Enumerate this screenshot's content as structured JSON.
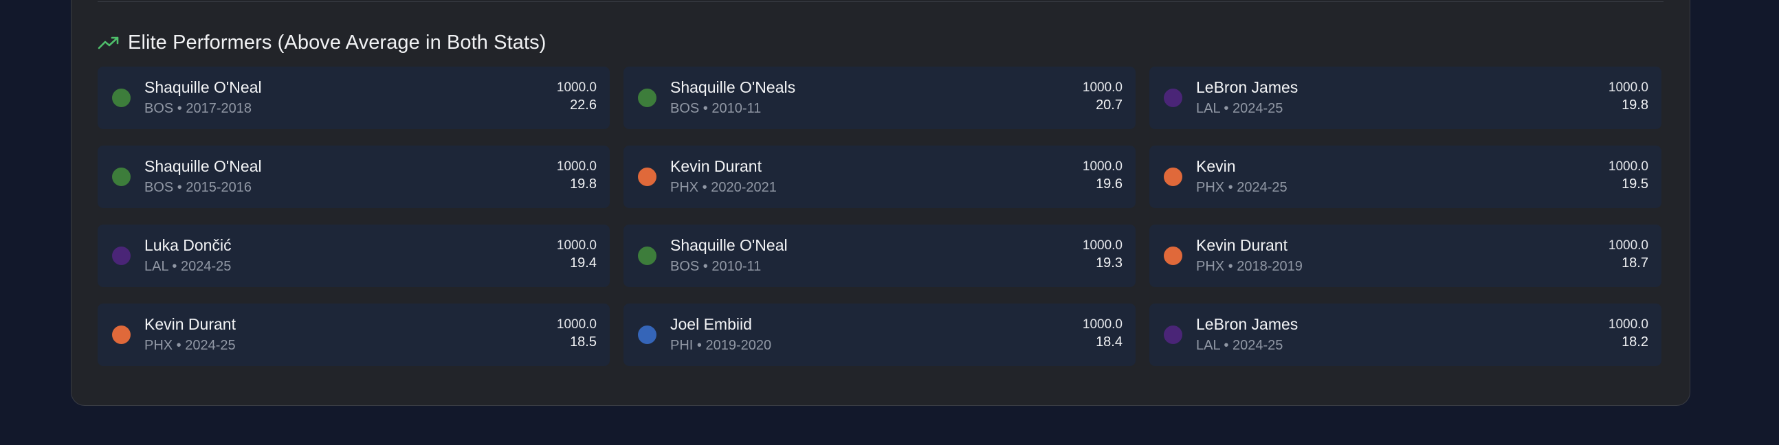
{
  "section": {
    "title": "Elite Performers (Above Average in Both Stats)",
    "icon": "trending-up-icon",
    "accent_color": "#4fbf6b"
  },
  "team_colors": {
    "BOS": "#3d7d3b",
    "LAL": "#4a2577",
    "PHX": "#e0693a",
    "PHI": "#3565b8"
  },
  "players": [
    {
      "name": "Shaquille O'Neal",
      "team": "BOS",
      "season": "2017-2018",
      "meta": "BOS • 2017-2018",
      "stat1": "1000.0",
      "stat2": "22.6"
    },
    {
      "name": "Shaquille O'Neals",
      "team": "BOS",
      "season": "2010-11",
      "meta": "BOS • 2010-11",
      "stat1": "1000.0",
      "stat2": "20.7"
    },
    {
      "name": "LeBron James",
      "team": "LAL",
      "season": "2024-25",
      "meta": "LAL • 2024-25",
      "stat1": "1000.0",
      "stat2": "19.8"
    },
    {
      "name": "Shaquille O'Neal",
      "team": "BOS",
      "season": "2015-2016",
      "meta": "BOS • 2015-2016",
      "stat1": "1000.0",
      "stat2": "19.8"
    },
    {
      "name": "Kevin Durant",
      "team": "PHX",
      "season": "2020-2021",
      "meta": "PHX • 2020-2021",
      "stat1": "1000.0",
      "stat2": "19.6"
    },
    {
      "name": "Kevin",
      "team": "PHX",
      "season": "2024-25",
      "meta": "PHX • 2024-25",
      "stat1": "1000.0",
      "stat2": "19.5"
    },
    {
      "name": "Luka Dončić",
      "team": "LAL",
      "season": "2024-25",
      "meta": "LAL • 2024-25",
      "stat1": "1000.0",
      "stat2": "19.4"
    },
    {
      "name": "Shaquille O'Neal",
      "team": "BOS",
      "season": "2010-11",
      "meta": "BOS • 2010-11",
      "stat1": "1000.0",
      "stat2": "19.3"
    },
    {
      "name": "Kevin Durant",
      "team": "PHX",
      "season": "2018-2019",
      "meta": "PHX • 2018-2019",
      "stat1": "1000.0",
      "stat2": "18.7"
    },
    {
      "name": "Kevin Durant",
      "team": "PHX",
      "season": "2024-25",
      "meta": "PHX • 2024-25",
      "stat1": "1000.0",
      "stat2": "18.5"
    },
    {
      "name": "Joel Embiid",
      "team": "PHI",
      "season": "2019-2020",
      "meta": "PHI • 2019-2020",
      "stat1": "1000.0",
      "stat2": "18.4"
    },
    {
      "name": "LeBron James",
      "team": "LAL",
      "season": "2024-25",
      "meta": "LAL • 2024-25",
      "stat1": "1000.0",
      "stat2": "18.2"
    }
  ]
}
